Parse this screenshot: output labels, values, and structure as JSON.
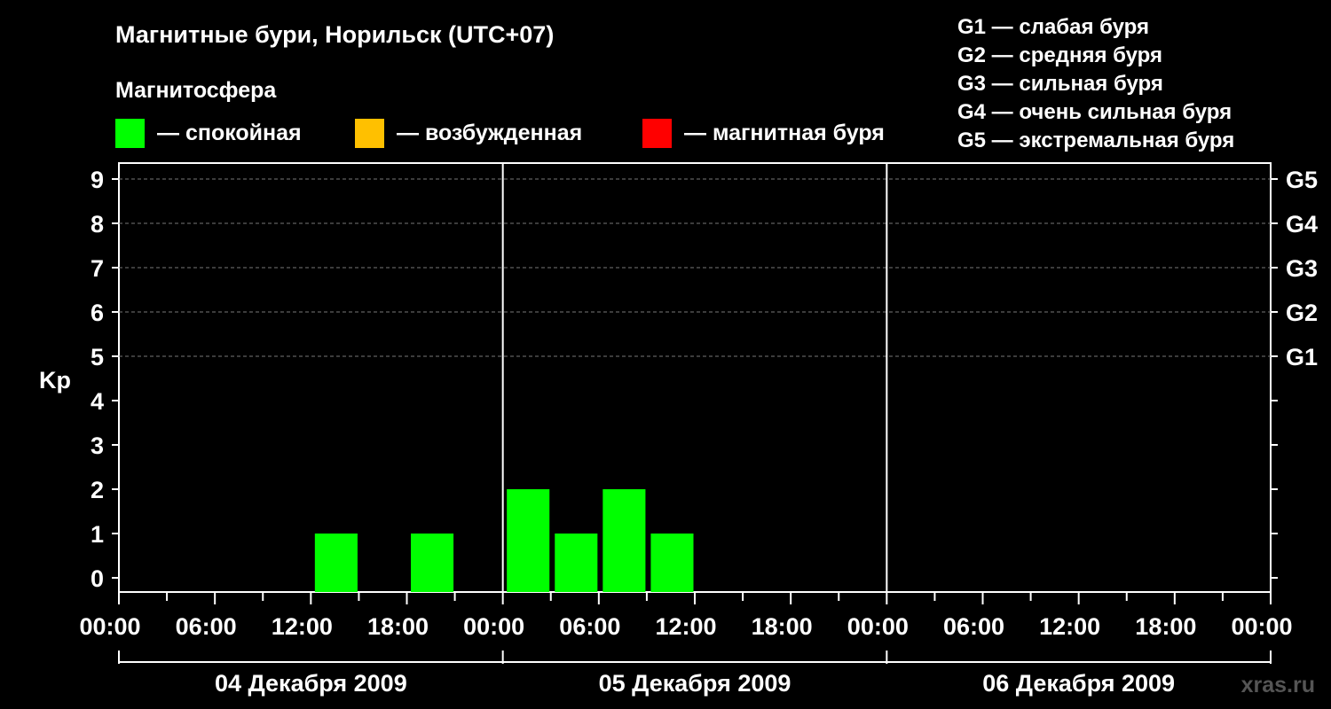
{
  "title": "Магнитные бури, Норильск (UTC+07)",
  "legend": {
    "heading": "Магнитосфера",
    "items": [
      {
        "label": "— спокойная",
        "color": "#00ff00"
      },
      {
        "label": "— возбужденная",
        "color": "#ffc000"
      },
      {
        "label": "— магнитная буря",
        "color": "#ff0000"
      }
    ],
    "storm_scale": [
      "G1 — слабая буря",
      "G2 — средняя буря",
      "G3 — сильная буря",
      "G4 — очень сильная буря",
      "G5 — экстремальная буря"
    ]
  },
  "watermark": "xras.ru",
  "chart_data": {
    "type": "bar",
    "title": "Магнитные бури, Норильск (UTC+07)",
    "ylabel": "Kp",
    "ylim": [
      0,
      9
    ],
    "y_ticks": [
      "0",
      "1",
      "2",
      "3",
      "4",
      "5",
      "6",
      "7",
      "8",
      "9"
    ],
    "right_ticks": [
      {
        "kp": 5,
        "label": "G1"
      },
      {
        "kp": 6,
        "label": "G2"
      },
      {
        "kp": 7,
        "label": "G3"
      },
      {
        "kp": 8,
        "label": "G4"
      },
      {
        "kp": 9,
        "label": "G5"
      }
    ],
    "grid": "dashed horizontal lines at Kp 5–9",
    "x_tick_labels": [
      "00:00",
      "06:00",
      "12:00",
      "18:00",
      "00:00",
      "06:00",
      "12:00",
      "18:00",
      "00:00",
      "06:00",
      "12:00",
      "18:00",
      "00:00"
    ],
    "days": [
      "04 Декабря 2009",
      "05 Декабря 2009",
      "06 Декабря 2009"
    ],
    "interval_hours": 3,
    "bars": [
      {
        "day": "04 Декабря 2009",
        "start": "12:00",
        "kp": 1,
        "color": "#00ff00"
      },
      {
        "day": "04 Декабря 2009",
        "start": "18:00",
        "kp": 1,
        "color": "#00ff00"
      },
      {
        "day": "05 Декабря 2009",
        "start": "00:00",
        "kp": 2,
        "color": "#00ff00"
      },
      {
        "day": "05 Декабря 2009",
        "start": "03:00",
        "kp": 1,
        "color": "#00ff00"
      },
      {
        "day": "05 Декабря 2009",
        "start": "06:00",
        "kp": 2,
        "color": "#00ff00"
      },
      {
        "day": "05 Декабря 2009",
        "start": "09:00",
        "kp": 1,
        "color": "#00ff00"
      }
    ]
  }
}
